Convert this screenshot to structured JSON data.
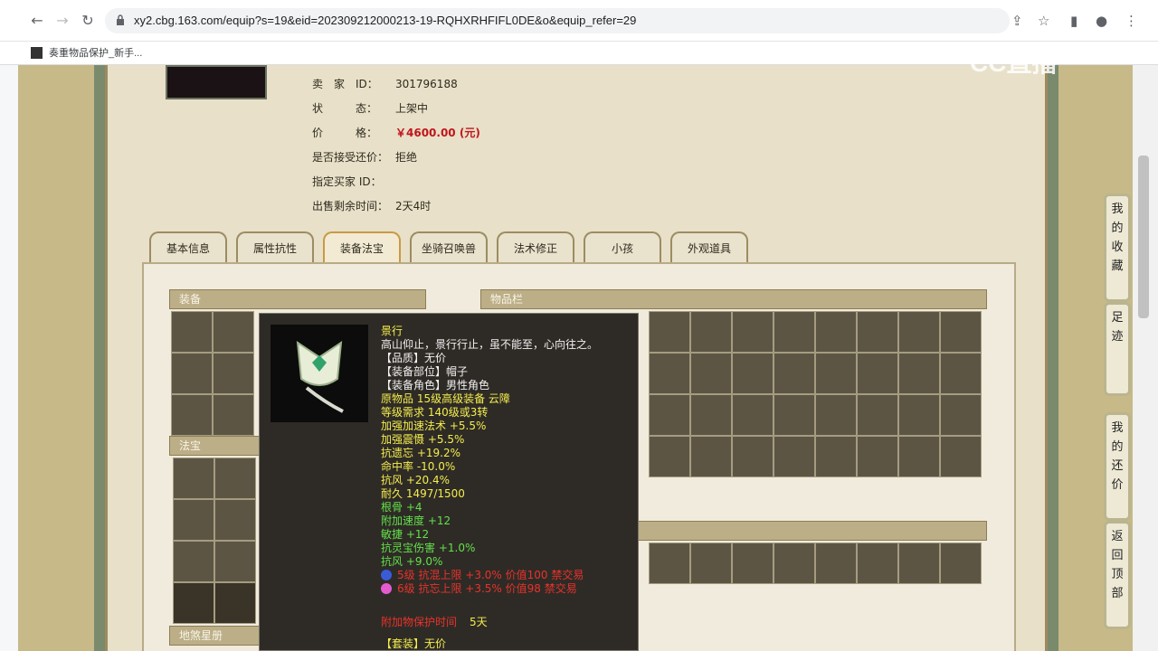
{
  "browser": {
    "url": "xy2.cbg.163.com/equip?s=19&eid=202309212000213-19-RQHXRHFIFL0DE&o&equip_refer=29",
    "bookmark": "奏重物品保护_新手..."
  },
  "watermark": "CC直播",
  "seller": {
    "rows": [
      {
        "label": "卖　家　ID：",
        "value": "301796188"
      },
      {
        "label": "状　　　态：",
        "value": "上架中"
      },
      {
        "label": "价　　　格：",
        "value": "￥4600.00 (元)"
      },
      {
        "label": "是否接受还价：",
        "value": "拒绝"
      },
      {
        "label": "指定买家 ID：",
        "value": ""
      },
      {
        "label": "出售剩余时间：",
        "value": "2天4时"
      }
    ]
  },
  "tabs": [
    "基本信息",
    "属性抗性",
    "装备法宝",
    "坐骑召唤兽",
    "法术修正",
    "小孩",
    "外观道具"
  ],
  "active_tab": "装备法宝",
  "sections": {
    "equipment": "装备",
    "fabao": "法宝",
    "inventory": "物品栏",
    "disha": "地煞星册"
  },
  "tooltip": {
    "name": "景行",
    "desc": "高山仰止，景行行止，虽不能至，心向往之。",
    "lines_white": [
      "【品质】无价",
      "【装备部位】帽子",
      "【装备角色】男性角色"
    ],
    "lines_yellow": [
      "原物品 15级高级装备 云障",
      "等级需求 140级或3转",
      "加强加速法术 +5.5%",
      "加强震慑 +5.5%",
      "抗遗忘 +19.2%",
      "命中率 -10.0%",
      "抗风 +20.4%",
      "耐久 1497/1500"
    ],
    "lines_green": [
      "根骨 +4",
      "附加速度 +12",
      "敏捷 +12",
      "抗灵宝伤害 +1.0%",
      "抗风 +9.0%"
    ],
    "gems": [
      {
        "text": "5级 抗混上限 +3.0% 价值100 禁交易",
        "color": "#3a5bd8"
      },
      {
        "text": "6级 抗忘上限 +3.5% 价值98 禁交易",
        "color": "#e45bd0"
      }
    ],
    "protect_label": "附加物保护时间",
    "protect_value": "5天",
    "footer": "【套装】无价"
  },
  "side_buttons": [
    "我的收藏",
    "足迹",
    "我的还价",
    "返回顶部"
  ],
  "colors": {
    "price": "#c0151b",
    "panel": "#f0ebdc",
    "accent": "#bcae86"
  }
}
